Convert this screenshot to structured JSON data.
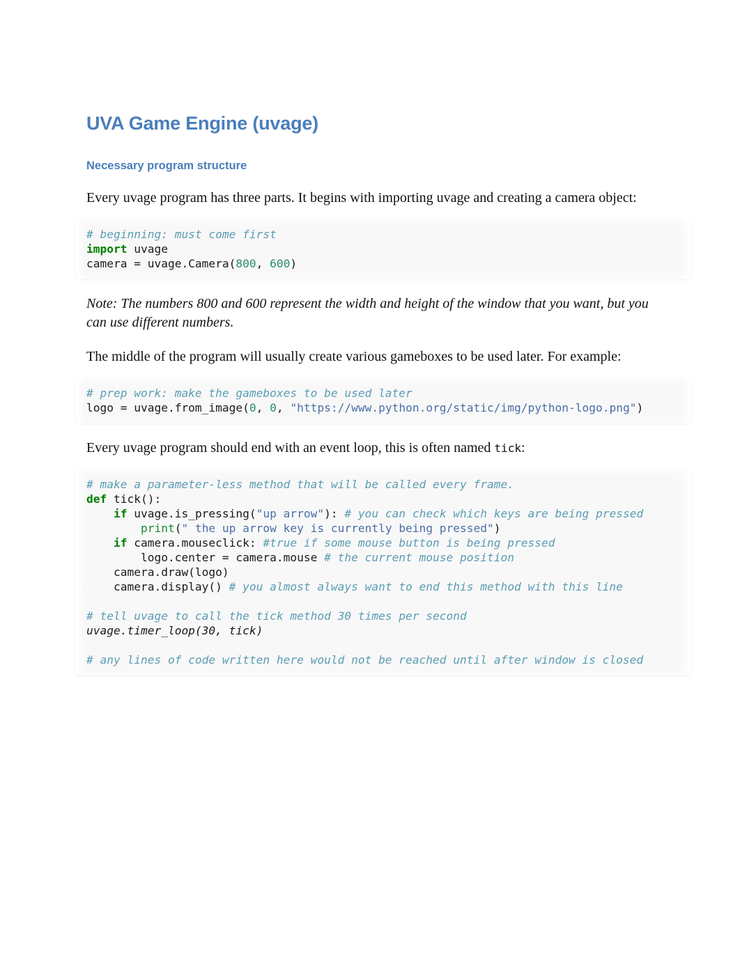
{
  "document": {
    "title": "UVA Game Engine (uvage)",
    "subtitle": "Necessary program structure",
    "paragraph_1": "Every uvage program has three parts. It begins with importing uvage and creating a camera object:",
    "note": "Note: The numbers 800 and 600 represent the width and height of the window that you want, but you can use different numbers.",
    "paragraph_2": "The middle of the program will usually create various gameboxes to be used later. For example:",
    "paragraph_3_pre": "Every uvage program should end with an event loop, this is often named ",
    "paragraph_3_code": "tick",
    "paragraph_3_post": ":"
  },
  "colors": {
    "heading": "#4a7ebb",
    "body_text": "#111111",
    "code_background": "#f8f8f8",
    "comment": "#5b9cb3",
    "keyword": "#008000",
    "builtin": "#1a8a2e",
    "number": "#2e8b6b",
    "string": "#4a6fa5",
    "code_plain": "#1a1a1a"
  },
  "code_blocks": [
    {
      "id": "code-block-1",
      "lines": [
        [
          {
            "t": "# beginning: must come first",
            "c": "cm"
          }
        ],
        [
          {
            "t": "import",
            "c": "kw"
          },
          {
            "t": " uvage",
            "c": "pln"
          }
        ],
        [
          {
            "t": "camera = uvage.Camera(",
            "c": "pln"
          },
          {
            "t": "800",
            "c": "num"
          },
          {
            "t": ", ",
            "c": "pln"
          },
          {
            "t": "600",
            "c": "num"
          },
          {
            "t": ")",
            "c": "pln"
          }
        ]
      ]
    },
    {
      "id": "code-block-2",
      "lines": [
        [
          {
            "t": "# prep work: make the gameboxes to be used later",
            "c": "cm"
          }
        ],
        [
          {
            "t": "logo = uvage.from_image(",
            "c": "pln"
          },
          {
            "t": "0",
            "c": "num"
          },
          {
            "t": ", ",
            "c": "pln"
          },
          {
            "t": "0",
            "c": "num"
          },
          {
            "t": ", ",
            "c": "pln"
          },
          {
            "t": "\"https://www.python.org/static/img/python-logo.png\"",
            "c": "str"
          },
          {
            "t": ")",
            "c": "pln"
          }
        ]
      ]
    },
    {
      "id": "code-block-3",
      "lines": [
        [
          {
            "t": "# make a parameter-less method that will be called every frame.",
            "c": "cm"
          }
        ],
        [
          {
            "t": "def",
            "c": "kw"
          },
          {
            "t": " tick():",
            "c": "pln"
          }
        ],
        [
          {
            "t": "    ",
            "c": "pln"
          },
          {
            "t": "if",
            "c": "kw"
          },
          {
            "t": " uvage.is_pressing(",
            "c": "pln"
          },
          {
            "t": "\"up arrow\"",
            "c": "str"
          },
          {
            "t": "): ",
            "c": "pln"
          },
          {
            "t": "# you can check which keys are being pressed",
            "c": "cm"
          }
        ],
        [
          {
            "t": "        ",
            "c": "pln"
          },
          {
            "t": "print",
            "c": "bi"
          },
          {
            "t": "(",
            "c": "pln"
          },
          {
            "t": "\" the up arrow key is currently being pressed\"",
            "c": "str"
          },
          {
            "t": ")",
            "c": "pln"
          }
        ],
        [
          {
            "t": "    ",
            "c": "pln"
          },
          {
            "t": "if",
            "c": "kw"
          },
          {
            "t": " camera.mouseclick: ",
            "c": "pln"
          },
          {
            "t": "#true if some mouse button is being pressed",
            "c": "cm"
          }
        ],
        [
          {
            "t": "        logo.center = camera.mouse ",
            "c": "pln"
          },
          {
            "t": "# the current mouse position",
            "c": "cm"
          }
        ],
        [
          {
            "t": "    camera.draw(logo)",
            "c": "pln"
          }
        ],
        [
          {
            "t": "    camera.display() ",
            "c": "pln"
          },
          {
            "t": "# you almost always want to end this method with this line",
            "c": "cm"
          }
        ],
        [
          {
            "t": "",
            "c": "pln"
          }
        ],
        [
          {
            "t": "# tell uvage to call the tick method 30 times per second",
            "c": "cm"
          }
        ],
        [
          {
            "t": "uvage.timer_loop(30, tick)",
            "c": "it"
          }
        ],
        [
          {
            "t": "",
            "c": "pln"
          }
        ],
        [
          {
            "t": "# any lines of code written here would not be reached until after window is closed",
            "c": "cm"
          }
        ]
      ]
    }
  ]
}
